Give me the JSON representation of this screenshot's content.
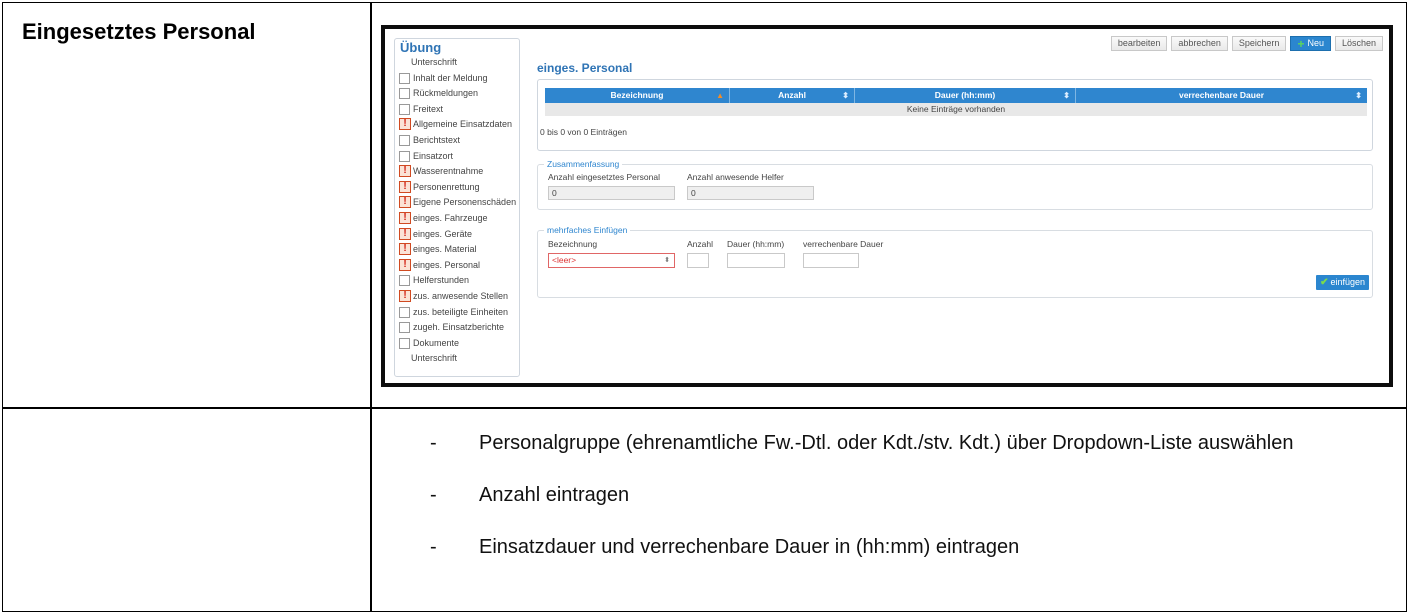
{
  "doc": {
    "row_title": "Eingesetztes Personal",
    "bullets": [
      "Personalgruppe (ehrenamtliche Fw.-Dtl. oder Kdt./stv. Kdt.) über Dropdown-Liste auswählen",
      "Anzahl eintragen",
      "Einsatzdauer und verrechenbare Dauer in (hh:mm) eintragen"
    ],
    "bullet_dash": "-"
  },
  "ui": {
    "nav": {
      "title": "Übung",
      "items": [
        {
          "label": "Unterschrift",
          "kind": "plain"
        },
        {
          "label": "Inhalt der Meldung",
          "kind": "check"
        },
        {
          "label": "Rückmeldungen",
          "kind": "check"
        },
        {
          "label": "Freitext",
          "kind": "check"
        },
        {
          "label": "Allgemeine Einsatzdaten",
          "kind": "warn"
        },
        {
          "label": "Berichtstext",
          "kind": "check"
        },
        {
          "label": "Einsatzort",
          "kind": "check"
        },
        {
          "label": "Wasserentnahme",
          "kind": "warn"
        },
        {
          "label": "Personenrettung",
          "kind": "warn"
        },
        {
          "label": "Eigene Personenschäden",
          "kind": "warn"
        },
        {
          "label": "einges. Fahrzeuge",
          "kind": "warn"
        },
        {
          "label": "einges. Geräte",
          "kind": "warn"
        },
        {
          "label": "einges. Material",
          "kind": "warn"
        },
        {
          "label": "einges. Personal",
          "kind": "warn"
        },
        {
          "label": "Helferstunden",
          "kind": "check"
        },
        {
          "label": "zus. anwesende Stellen",
          "kind": "warn"
        },
        {
          "label": "zus. beteiligte Einheiten",
          "kind": "check"
        },
        {
          "label": "zugeh. Einsatzberichte",
          "kind": "check"
        },
        {
          "label": "Dokumente",
          "kind": "check"
        },
        {
          "label": "Unterschrift",
          "kind": "plain"
        }
      ],
      "warn_glyph": "!"
    },
    "toolbar": {
      "edit": "bearbeiten",
      "cancel": "abbrechen",
      "save": "Speichern",
      "new_plus": "+",
      "new": "Neu",
      "delete": "Löschen"
    },
    "section_title": "einges. Personal",
    "grid": {
      "columns": [
        "Bezeichnung",
        "Anzahl",
        "Dauer (hh:mm)",
        "verrechenbare Dauer"
      ],
      "empty": "Keine Einträge vorhanden",
      "info": "0 bis 0 von 0 Einträgen"
    },
    "summary": {
      "legend": "Zusammenfassung",
      "label_personal": "Anzahl eingesetztes Personal",
      "label_helfer": "Anzahl anwesende Helfer",
      "value_personal": "0",
      "value_helfer": "0"
    },
    "multi": {
      "legend": "mehrfaches Einfügen",
      "label_bezeichnung": "Bezeichnung",
      "label_anzahl": "Anzahl",
      "label_dauer": "Dauer (hh:mm)",
      "label_verrechenbar": "verrechenbare Dauer",
      "select_value": "<leer>",
      "button_check": "✔",
      "button": "einfügen"
    }
  }
}
